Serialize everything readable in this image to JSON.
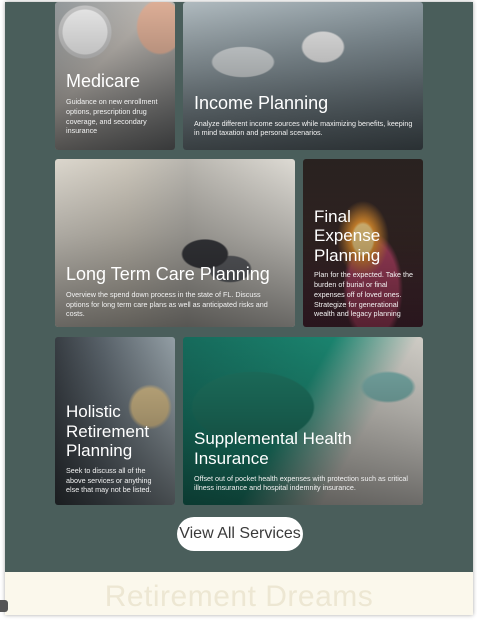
{
  "services": [
    {
      "id": "medicare",
      "title": "Medicare",
      "description": "Guidance on new enrollment options, prescription drug coverage, and secondary insurance"
    },
    {
      "id": "income-planning",
      "title": "Income Planning",
      "description": "Analyze different income sources while maximizing benefits, keeping in mind taxation and personal scenarios."
    },
    {
      "id": "long-term-care",
      "title": "Long Term Care Planning",
      "description": "Overview the spend down process in the state of FL. Discuss options for long term care plans as well as anticipated risks and costs."
    },
    {
      "id": "final-expense",
      "title": "Final Expense Planning",
      "description": "Plan for the expected. Take the burden of burial or final expenses off of loved ones. Strategize for generational wealth and legacy planning"
    },
    {
      "id": "holistic",
      "title": "Holistic Retirement Planning",
      "description": "Seek to discuss all of the above services or anything else that may not be listed."
    },
    {
      "id": "supplemental",
      "title": "Supplemental Health Insurance",
      "description": "Offset out of pocket health expenses with protection such as critical illness insurance and hospital indemnity insurance."
    }
  ],
  "cta": {
    "label": "View All Services"
  },
  "next_section": {
    "heading": "Retirement Dreams"
  },
  "colors": {
    "section_bg": "#4a5e5b",
    "next_bg": "#fbf8ec",
    "button_bg": "#ffffff"
  }
}
